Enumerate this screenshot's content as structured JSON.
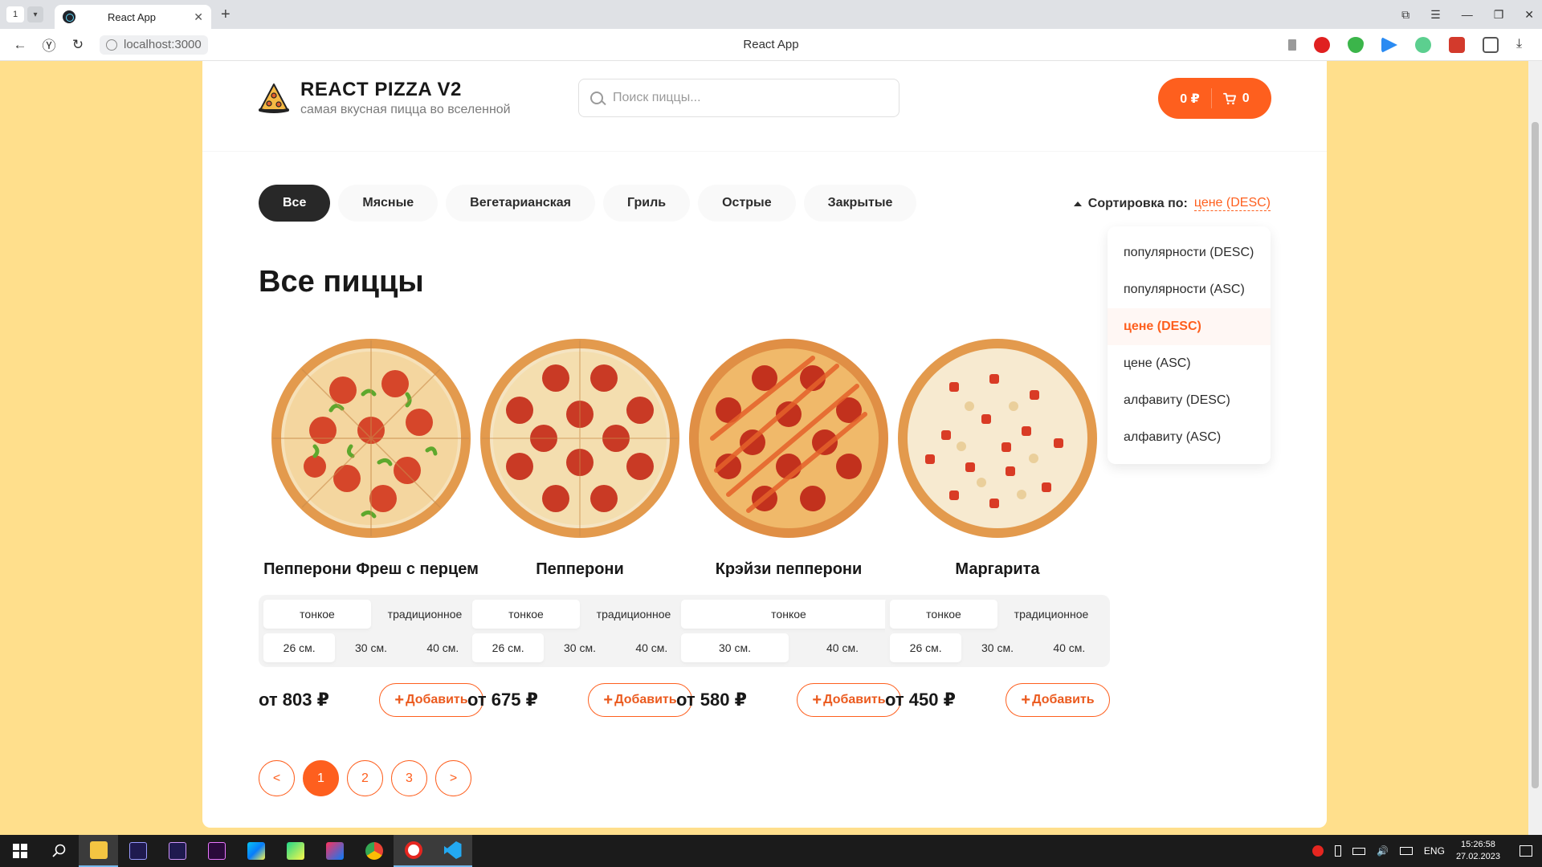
{
  "browser": {
    "tab_count": "1",
    "tab_title": "React App",
    "url": "localhost:3000",
    "page_title": "React App"
  },
  "header": {
    "logo_title": "REACT PIZZA V2",
    "logo_subtitle": "самая вкусная пицца во вселенной",
    "search_placeholder": "Поиск пиццы...",
    "cart_total": "0 ₽",
    "cart_count": "0"
  },
  "categories": [
    "Все",
    "Мясные",
    "Вегетарианская",
    "Гриль",
    "Острые",
    "Закрытые"
  ],
  "sort": {
    "label": "Сортировка по:",
    "value": "цене (DESC)",
    "options": [
      "популярности (DESC)",
      "популярности (ASC)",
      "цене (DESC)",
      "цене (ASC)",
      "алфавиту (DESC)",
      "алфавиту (ASC)"
    ]
  },
  "heading": "Все пиццы",
  "pizzas": [
    {
      "title": "Пепперони Фреш с перцем",
      "types": [
        "тонкое",
        "традиционное"
      ],
      "sizes": [
        "26 см.",
        "30 см.",
        "40 см."
      ],
      "price": "от 803 ₽",
      "add": "Добавить"
    },
    {
      "title": "Пепперони",
      "types": [
        "тонкое",
        "традиционное"
      ],
      "sizes": [
        "26 см.",
        "30 см.",
        "40 см."
      ],
      "price": "от 675 ₽",
      "add": "Добавить"
    },
    {
      "title": "Крэйзи пепперони",
      "types": [
        "тонкое"
      ],
      "sizes": [
        "30 см.",
        "40 см."
      ],
      "price": "от 580 ₽",
      "add": "Добавить"
    },
    {
      "title": "Маргарита",
      "types": [
        "тонкое",
        "традиционное"
      ],
      "sizes": [
        "26 см.",
        "30 см.",
        "40 см."
      ],
      "price": "от 450 ₽",
      "add": "Добавить"
    }
  ],
  "pagination": [
    "<",
    "1",
    "2",
    "3",
    ">"
  ],
  "taskbar": {
    "lang": "ENG",
    "time": "15:26:58",
    "date": "27.02.2023"
  },
  "colors": {
    "accent": "#fe5f1e",
    "background": "#ffdf8c",
    "dark": "#282828"
  }
}
